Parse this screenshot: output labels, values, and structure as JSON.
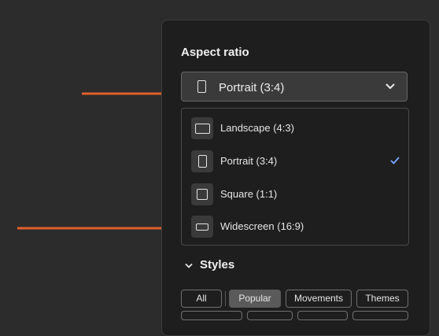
{
  "aspect_ratio": {
    "title": "Aspect ratio",
    "selected_label": "Portrait (3:4)",
    "options": [
      {
        "label": "Landscape (4:3)",
        "icon": "landscape-icon",
        "selected": false
      },
      {
        "label": "Portrait (3:4)",
        "icon": "portrait-icon",
        "selected": true
      },
      {
        "label": "Square (1:1)",
        "icon": "square-icon",
        "selected": false
      },
      {
        "label": "Widescreen (16:9)",
        "icon": "widescreen-icon",
        "selected": false
      }
    ]
  },
  "styles": {
    "title": "Styles",
    "chips": [
      "All",
      "Popular",
      "Movements",
      "Themes"
    ],
    "active_chip": "Popular"
  },
  "colors": {
    "annotation_arrow": "#e0602a",
    "checkmark": "#7aa8ff",
    "panel_bg": "#1e1e1e",
    "page_bg": "#2c2c2c"
  }
}
